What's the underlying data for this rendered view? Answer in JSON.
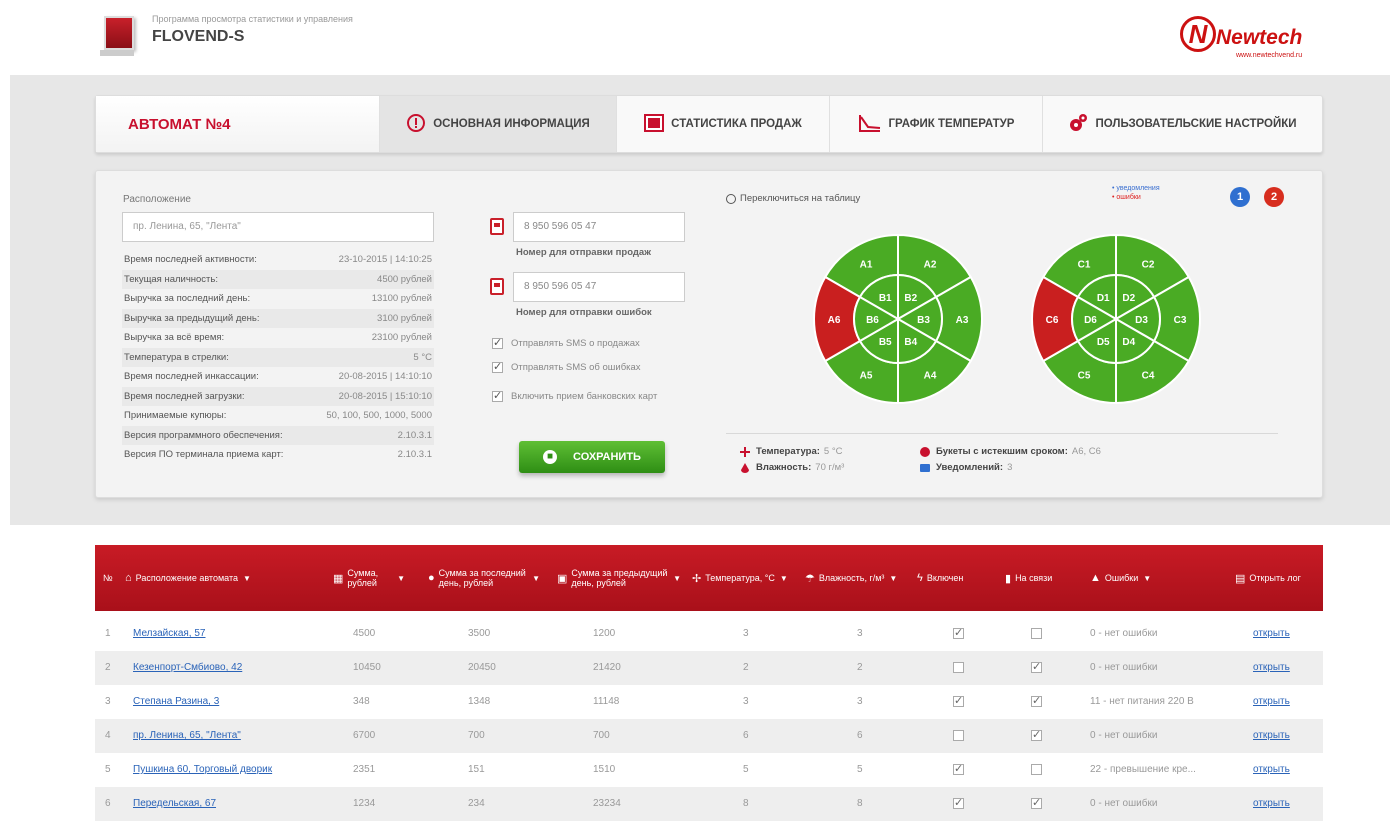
{
  "header": {
    "subtitle": "Программа просмотра статистики и управления",
    "app_name": "FLOVEND-S",
    "brand_name": "Newtech",
    "brand_letter": "N",
    "brand_url": "www.newtechvend.ru"
  },
  "tabs": {
    "title": "АВТОМАТ №4",
    "items": [
      {
        "label": "ОСНОВНАЯ ИНФОРМАЦИЯ",
        "icon": "alert-circle-icon",
        "active": true
      },
      {
        "label": "СТАТИСТИКА ПРОДАЖ",
        "icon": "sales-stats-icon",
        "active": false
      },
      {
        "label": "ГРАФИК ТЕМПЕРАТУР",
        "icon": "temperature-chart-icon",
        "active": false
      },
      {
        "label": "ПОЛЬЗОВАТЕЛЬСКИЕ НАСТРОЙКИ",
        "icon": "gears-icon",
        "active": false
      }
    ]
  },
  "location": {
    "label": "Расположение",
    "value": "пр. Ленина, 65, \"Лента\""
  },
  "info": [
    {
      "key": "Время последней активности:",
      "value": "23-10-2015  |  14:10:25"
    },
    {
      "key": "Текущая наличность:",
      "value": "4500 рублей"
    },
    {
      "key": "Выручка за последний день:",
      "value": "13100 рублей"
    },
    {
      "key": "Выручка за предыдущий день:",
      "value": "3100 рублей"
    },
    {
      "key": "Выручка за всё время:",
      "value": "23100 рублей"
    },
    {
      "key": "Температура в стрелки:",
      "value": "5 °C"
    },
    {
      "key": "Время последней инкассации:",
      "value": "20-08-2015  |  14:10:10"
    },
    {
      "key": "Время последней загрузки:",
      "value": "20-08-2015  |  15:10:10"
    },
    {
      "key": "Принимаемые купюры:",
      "value": "50, 100, 500, 1000, 5000"
    },
    {
      "key": "Версия программного обеспечения:",
      "value": "2.10.3.1"
    },
    {
      "key": "Версия ПО терминала приема карт:",
      "value": "2.10.3.1"
    }
  ],
  "sms": {
    "sales_phone": "8 950 596 05 47",
    "sales_caption": "Номер для отправки продаж",
    "errors_phone": "8 950 596 05 47",
    "errors_caption": "Номер для отправки ошибок",
    "checks": [
      {
        "label": "Отправлять SMS о продажах",
        "checked": true
      },
      {
        "label": "Отправлять SMS об ошибках",
        "checked": true
      },
      {
        "label": "Включить прием банковских карт",
        "checked": true
      }
    ],
    "save_label": "СОХРАНИТЬ"
  },
  "switch_label": "Переключиться на таблицу",
  "mini_legend": {
    "notify": "• уведомления",
    "errors": "• ошибки"
  },
  "badges": {
    "blue": "1",
    "red": "2"
  },
  "wheels": [
    {
      "outer": [
        "A1",
        "A2",
        "A3",
        "A4",
        "A5",
        "A6"
      ],
      "inner": [
        "B1",
        "B2",
        "B3",
        "B4",
        "B5",
        "B6"
      ],
      "red_outer": [
        "A6"
      ]
    },
    {
      "outer": [
        "C1",
        "C2",
        "C3",
        "C4",
        "C5",
        "C6"
      ],
      "inner": [
        "D1",
        "D2",
        "D3",
        "D4",
        "D5",
        "D6"
      ],
      "red_outer": [
        "C6"
      ]
    }
  ],
  "status": {
    "temperature_label": "Температура:",
    "temperature_value": "5 °C",
    "humidity_label": "Влажность:",
    "humidity_value": "70 г/м³",
    "expired_label": "Букеты с истекшим сроком:",
    "expired_value": "A6, C6",
    "notices_label": "Уведомлений:",
    "notices_value": "3"
  },
  "colors": {
    "brand_red": "#c8102e",
    "green": "#4aab24",
    "alert_red": "#c91f1f"
  },
  "table": {
    "headers": {
      "num": "№",
      "location": "Расположение автомата",
      "sum": "Сумма, рублей",
      "last_day": "Сумма за последний день, рублей",
      "prev_day": "Сумма за предыдущий день, рублей",
      "temp": "Температура, °С",
      "humidity": "Влажность, г/м³",
      "enabled": "Включен",
      "online": "На связи",
      "errors": "Ошибки",
      "open": "Открыть лог"
    },
    "rows": [
      {
        "num": "1",
        "location": "Мелзайская, 57",
        "sum": "4500",
        "last_day": "3500",
        "prev_day": "1200",
        "temp": "3",
        "humidity": "3",
        "enabled": true,
        "online": false,
        "error": "0 - нет ошибки",
        "open": "открыть"
      },
      {
        "num": "2",
        "location": "Кезенпорт-Смбиово, 42",
        "sum": "10450",
        "last_day": "20450",
        "prev_day": "21420",
        "temp": "2",
        "humidity": "2",
        "enabled": false,
        "online": true,
        "error": "0 - нет ошибки",
        "open": "открыть"
      },
      {
        "num": "3",
        "location": "Степана Разина, 3",
        "sum": "348",
        "last_day": "1348",
        "prev_day": "11148",
        "temp": "3",
        "humidity": "3",
        "enabled": true,
        "online": true,
        "error": "11 - нет питания 220 В",
        "open": "открыть"
      },
      {
        "num": "4",
        "location": "пр. Ленина, 65, \"Лента\"",
        "sum": "6700",
        "last_day": "700",
        "prev_day": "700",
        "temp": "6",
        "humidity": "6",
        "enabled": false,
        "online": true,
        "error": "0 - нет ошибки",
        "open": "открыть"
      },
      {
        "num": "5",
        "location": "Пушкина 60, Торговый дворик",
        "sum": "2351",
        "last_day": "151",
        "prev_day": "1510",
        "temp": "5",
        "humidity": "5",
        "enabled": true,
        "online": false,
        "error": "22 - превышение кре...",
        "open": "открыть"
      },
      {
        "num": "6",
        "location": "Передельская, 67",
        "sum": "1234",
        "last_day": "234",
        "prev_day": "23234",
        "temp": "8",
        "humidity": "8",
        "enabled": true,
        "online": true,
        "error": "0 - нет ошибки",
        "open": "открыть"
      }
    ]
  }
}
